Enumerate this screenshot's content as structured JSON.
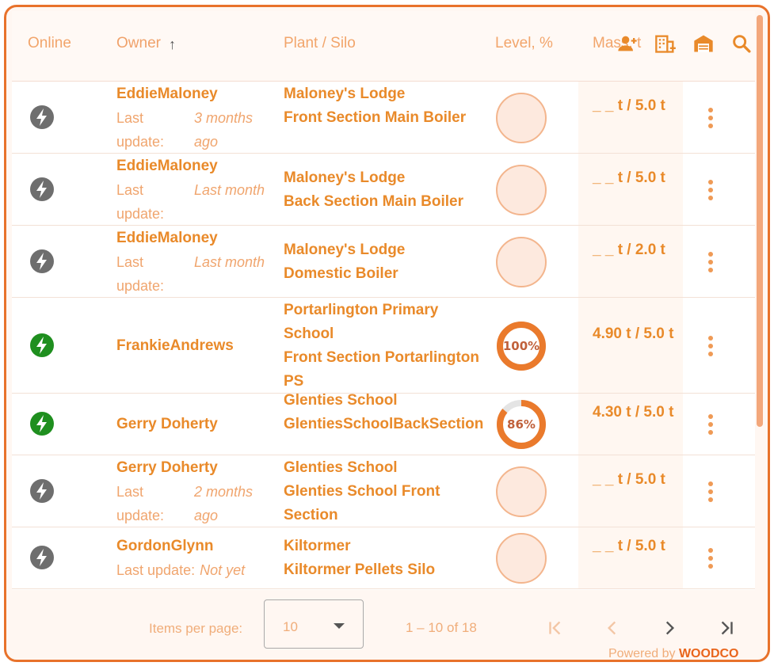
{
  "header": {
    "online": "Online",
    "owner": "Owner",
    "sort_arrow": "↑",
    "plant": "Plant / Silo",
    "level": "Level, %",
    "mass": "Mass, t"
  },
  "toolbar": {
    "icons": [
      "add-user-icon",
      "add-building-icon",
      "warehouse-icon",
      "search-icon"
    ]
  },
  "colors": {
    "accent": "#e98a2a",
    "border": "#e8722b",
    "online": "#1f8f1f",
    "offline": "#6e6e6e",
    "gauge_empty": "#fde9de",
    "gauge_fill": "#ea7a2c"
  },
  "rows": [
    {
      "online": false,
      "owner": "EddieMaloney",
      "update_label": "Last update:",
      "update_value": "3 months ago",
      "plant": "Maloney's Lodge",
      "silo": "Front Section Main Boiler",
      "level": null,
      "level_text": "",
      "mass": "_ _ t / 5.0 t"
    },
    {
      "online": false,
      "owner": "EddieMaloney",
      "update_label": "Last update:",
      "update_value": "Last month",
      "plant": "Maloney's Lodge",
      "silo": "Back Section Main Boiler",
      "level": null,
      "level_text": "",
      "mass": "_ _ t / 5.0 t"
    },
    {
      "online": false,
      "owner": "EddieMaloney",
      "update_label": "Last update:",
      "update_value": "Last month",
      "plant": "Maloney's Lodge",
      "silo": "Domestic Boiler",
      "level": null,
      "level_text": "",
      "mass": "_ _ t / 2.0 t"
    },
    {
      "online": true,
      "owner": "FrankieAndrews",
      "update_label": "",
      "update_value": "",
      "plant": "Portarlington Primary School",
      "silo": "Front Section Portarlington PS",
      "level": 100,
      "level_text": "100%",
      "mass": "4.90 t / 5.0 t"
    },
    {
      "online": true,
      "owner": "Gerry Doherty",
      "update_label": "",
      "update_value": "",
      "plant": "Glenties School",
      "silo": "GlentiesSchoolBackSection",
      "level": 86,
      "level_text": "86%",
      "mass": "4.30 t / 5.0 t"
    },
    {
      "online": false,
      "owner": "Gerry Doherty",
      "update_label": "Last update:",
      "update_value": "2 months ago",
      "plant": "Glenties School",
      "silo": "Glenties School Front Section",
      "level": null,
      "level_text": "",
      "mass": "_ _ t / 5.0 t"
    },
    {
      "online": false,
      "owner": "GordonGlynn",
      "update_label": "Last update:",
      "update_value": "Not yet",
      "plant": "Kiltormer",
      "silo": "Kiltormer Pellets Silo",
      "level": null,
      "level_text": "",
      "mass": "_ _ t / 5.0 t"
    }
  ],
  "footer": {
    "items_per_page_label": "Items per page:",
    "items_per_page_value": "10",
    "range": "1 – 10 of 18",
    "powered_prefix": "Powered by",
    "powered_brand": "WOODCO"
  }
}
